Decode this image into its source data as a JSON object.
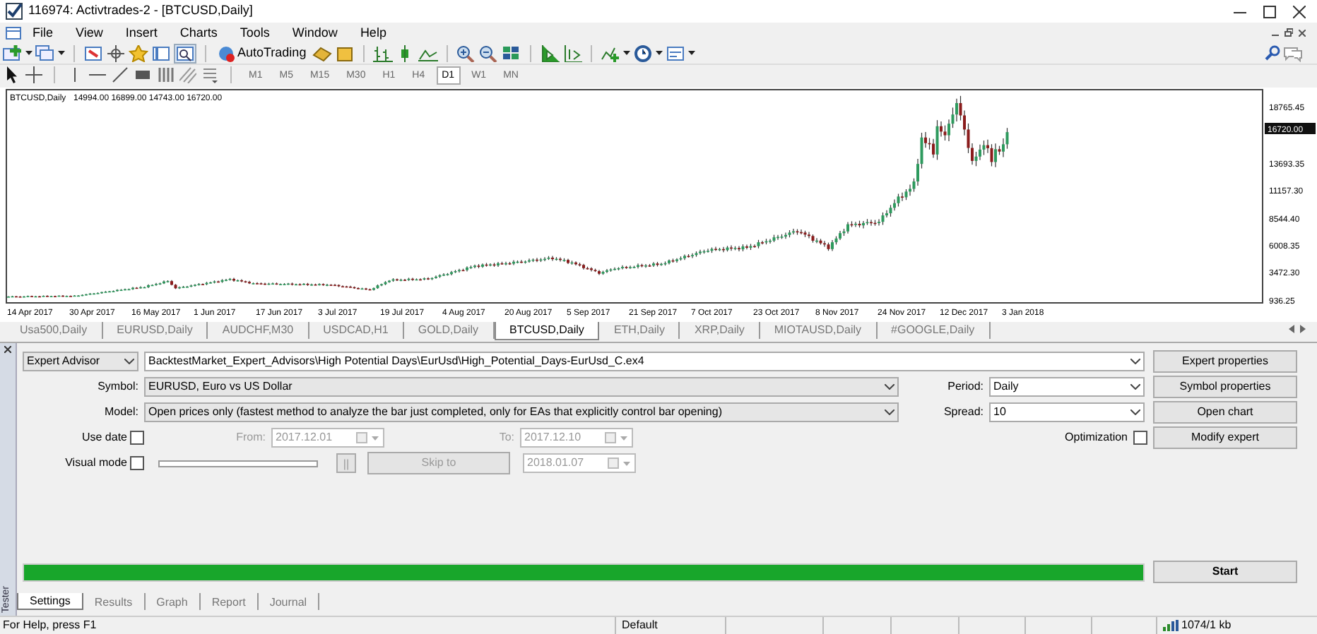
{
  "window": {
    "title": "116974: Activtrades-2 - [BTCUSD,Daily]"
  },
  "menu": [
    "File",
    "View",
    "Insert",
    "Charts",
    "Tools",
    "Window",
    "Help"
  ],
  "toolbar": {
    "autotrading": "AutoTrading",
    "tester_toggle_on": true
  },
  "timeframes": [
    {
      "label": "M1",
      "selected": false
    },
    {
      "label": "M5",
      "selected": false
    },
    {
      "label": "M15",
      "selected": false
    },
    {
      "label": "M30",
      "selected": false
    },
    {
      "label": "H1",
      "selected": false
    },
    {
      "label": "H4",
      "selected": false
    },
    {
      "label": "D1",
      "selected": true
    },
    {
      "label": "W1",
      "selected": false
    },
    {
      "label": "MN",
      "selected": false
    }
  ],
  "chart": {
    "symbol": "BTCUSD,Daily",
    "ohlc": "14994.00 16899.00 14743.00 16720.00",
    "current_price": "16720.00",
    "price_labels": [
      "18765.45",
      "13693.35",
      "11157.30",
      "8544.40",
      "6008.35",
      "3472.30",
      "936.25"
    ],
    "date_labels": [
      "14 Apr 2017",
      "30 Apr 2017",
      "16 May 2017",
      "1 Jun 2017",
      "17 Jun 2017",
      "3 Jul 2017",
      "19 Jul 2017",
      "4 Aug 2017",
      "20 Aug 2017",
      "5 Sep 2017",
      "21 Sep 2017",
      "7 Oct 2017",
      "23 Oct 2017",
      "8 Nov 2017",
      "24 Nov 2017",
      "12 Dec 2017",
      "3 Jan 2018"
    ]
  },
  "chart_tabs": [
    {
      "label": "Usa500,Daily",
      "selected": false
    },
    {
      "label": "EURUSD,Daily",
      "selected": false
    },
    {
      "label": "AUDCHF,M30",
      "selected": false
    },
    {
      "label": "USDCAD,H1",
      "selected": false
    },
    {
      "label": "GOLD,Daily",
      "selected": false
    },
    {
      "label": "BTCUSD,Daily",
      "selected": true
    },
    {
      "label": "ETH,Daily",
      "selected": false
    },
    {
      "label": "XRP,Daily",
      "selected": false
    },
    {
      "label": "MIOTAUSD,Daily",
      "selected": false
    },
    {
      "label": "#GOOGLE,Daily",
      "selected": false
    }
  ],
  "tester": {
    "side_label": "Tester",
    "type": "Expert Advisor",
    "expert": "BacktestMarket_Expert_Advisors\\High Potential Days\\EurUsd\\High_Potential_Days-EurUsd_C.ex4",
    "symbol_label": "Symbol:",
    "symbol": "EURUSD, Euro vs US Dollar",
    "model_label": "Model:",
    "model": "Open prices only (fastest method to analyze the bar just completed, only for EAs that explicitly control bar opening)",
    "period_label": "Period:",
    "period": "Daily",
    "spread_label": "Spread:",
    "spread": "10",
    "use_date": {
      "label": "Use date",
      "checked": false
    },
    "from_label": "From:",
    "from": {
      "value": "2017.12.01",
      "disabled": true
    },
    "to_label": "To:",
    "to": {
      "value": "2017.12.10",
      "disabled": true
    },
    "optimization": {
      "label": "Optimization",
      "checked": false
    },
    "visual_mode": {
      "label": "Visual mode",
      "checked": false
    },
    "pause": {
      "label": "||",
      "disabled": true
    },
    "skip_to": {
      "label": "Skip to",
      "disabled": true
    },
    "skip_date": {
      "value": "2018.01.07",
      "disabled": true
    },
    "buttons": [
      "Expert properties",
      "Symbol properties",
      "Open chart",
      "Modify expert"
    ],
    "progress": {
      "level": 1
    },
    "start": "Start",
    "tabs": [
      {
        "label": "Settings",
        "selected": true
      },
      {
        "label": "Results",
        "selected": false
      },
      {
        "label": "Graph",
        "selected": false
      },
      {
        "label": "Report",
        "selected": false
      },
      {
        "label": "Journal",
        "selected": false
      }
    ]
  },
  "status_bar": {
    "help": "For Help, press F1",
    "profile": "Default",
    "traffic": "1074/1 kb"
  }
}
